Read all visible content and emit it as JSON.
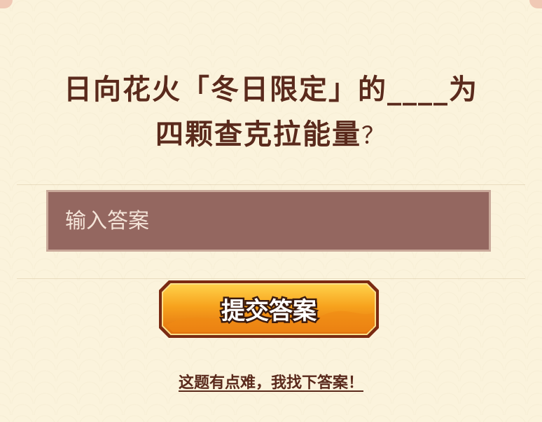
{
  "question": {
    "line1": "日向花火「冬日限定」的____为",
    "line2": "四颗查克拉能量",
    "mark": "？"
  },
  "answer": {
    "placeholder": "输入答案"
  },
  "submit": {
    "label": "提交答案"
  },
  "hint": {
    "label": "这题有点难，我找下答案！"
  },
  "colors": {
    "background": "#fbf3dc",
    "question_text": "#5a2a1c",
    "input_bg": "#946760",
    "button_orange": "#f39a1b",
    "button_border": "#7a2a12"
  }
}
